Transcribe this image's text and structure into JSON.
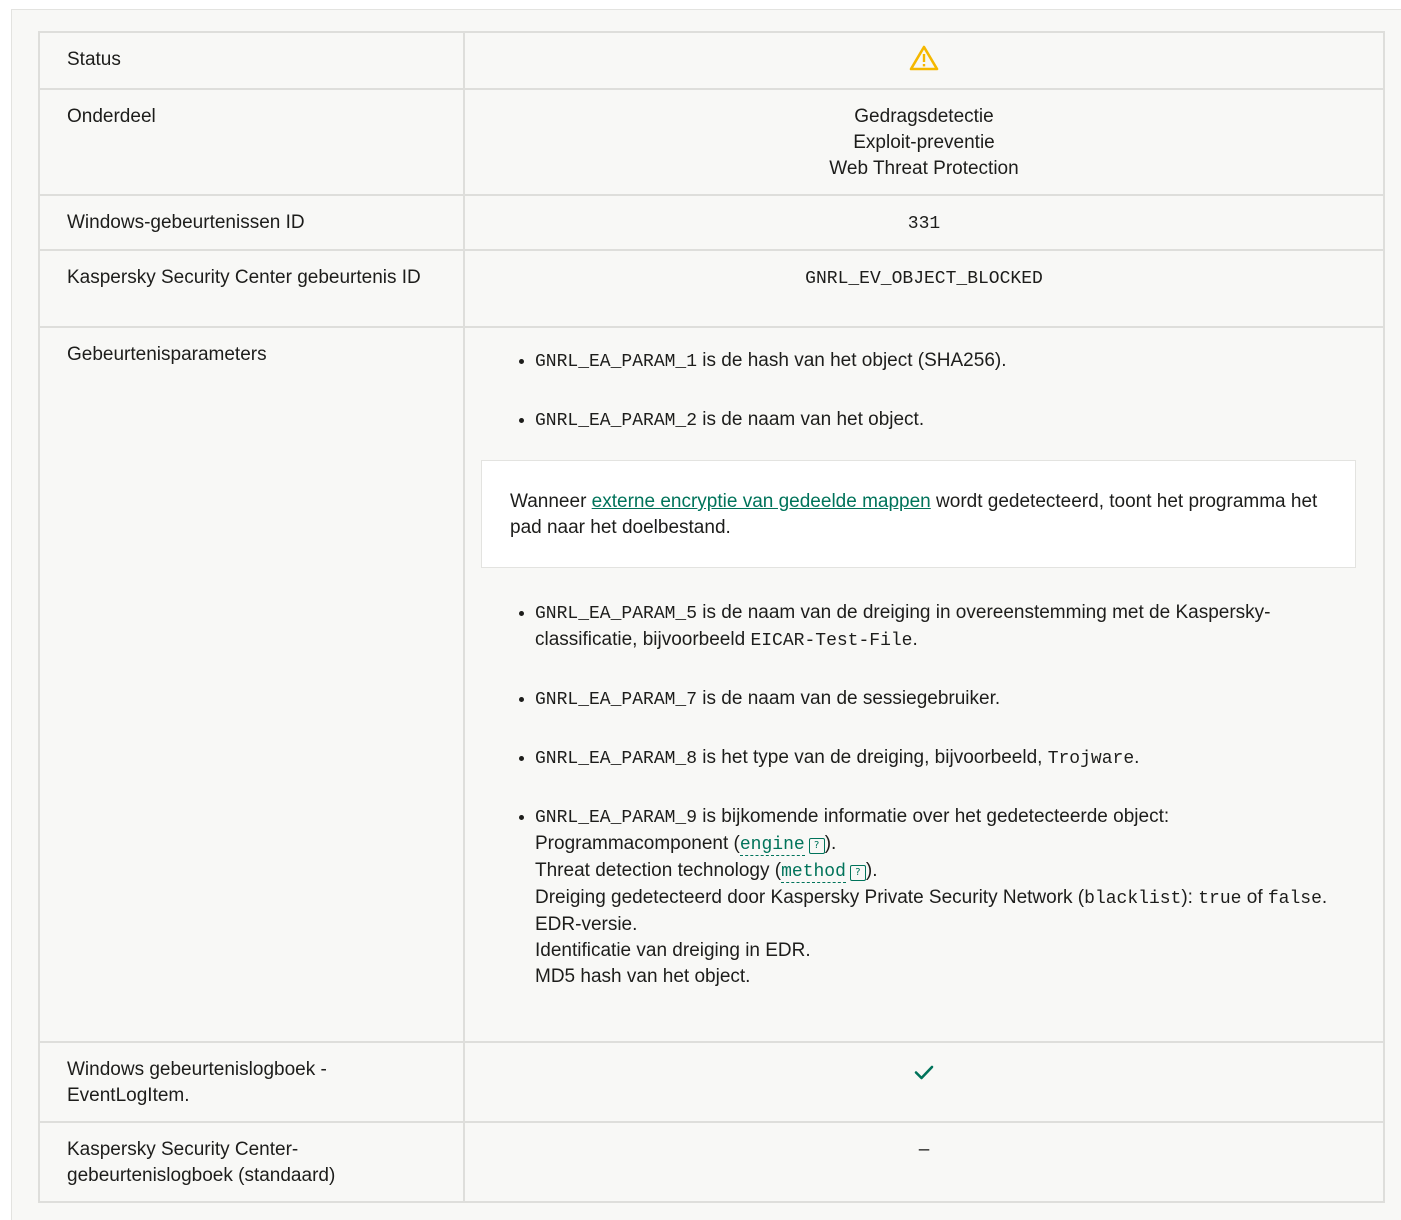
{
  "rows": {
    "status": {
      "label": "Status",
      "icon": "warning-icon",
      "icon_color": "#f5b800"
    },
    "onderdeel": {
      "label": "Onderdeel",
      "values": [
        "Gedragsdetectie",
        "Exploit-preventie",
        "Web Threat Protection"
      ]
    },
    "windows_id": {
      "label": "Windows-gebeurtenissen ID",
      "value": "331"
    },
    "ksc_id": {
      "label": "Kaspersky Security Center gebeurtenis ID",
      "value": "GNRL_EV_OBJECT_BLOCKED"
    },
    "params": {
      "label": "Gebeurtenisparameters",
      "items": [
        {
          "code": "GNRL_EA_PARAM_1",
          "text": " is de hash van het object (SHA256)."
        },
        {
          "code": "GNRL_EA_PARAM_2",
          "text": " is de naam van het object."
        }
      ],
      "note": {
        "before": "Wanneer ",
        "link": "externe encryptie van gedeelde mappen",
        "after": " wordt gedetecteerd, toont het programma het pad naar het doelbestand."
      },
      "param5": {
        "code": "GNRL_EA_PARAM_5",
        "text": " is de naam van de dreiging in overeenstemming met de Kaspersky-classificatie, bijvoorbeeld ",
        "example": "EICAR-Test-File",
        "end": "."
      },
      "param7": {
        "code": "GNRL_EA_PARAM_7",
        "text": " is de naam van de sessiegebruiker."
      },
      "param8": {
        "code": "GNRL_EA_PARAM_8",
        "text": " is het type van de dreiging, bijvoorbeeld, ",
        "example": "Trojware",
        "end": "."
      },
      "param9": {
        "code": "GNRL_EA_PARAM_9",
        "text": " is bijkomende informatie over het gedetecteerde object:",
        "line1_before": "Programmacomponent (",
        "line1_term": "engine",
        "line1_after": ").",
        "line2_before": "Threat detection technology (",
        "line2_term": "method",
        "line2_after": ").",
        "line3_before": "Dreiging gedetecteerd door Kaspersky Private Security Network (",
        "line3_code": "blacklist",
        "line3_mid": "): ",
        "line3_true": "true",
        "line3_of": " of ",
        "line3_false": "false",
        "line3_end": ".",
        "line4": "EDR-versie.",
        "line5": "Identificatie van dreiging in EDR.",
        "line6": "MD5 hash van het object."
      },
      "help_icon": "?"
    },
    "win_log": {
      "label": "Windows gebeurtenislogboek - EventLogItem.",
      "icon": "checkmark-icon",
      "icon_color": "#00735a"
    },
    "ksc_log": {
      "label": "Kaspersky Security Center-gebeurtenislogboek (standaard)",
      "value": "–"
    }
  }
}
